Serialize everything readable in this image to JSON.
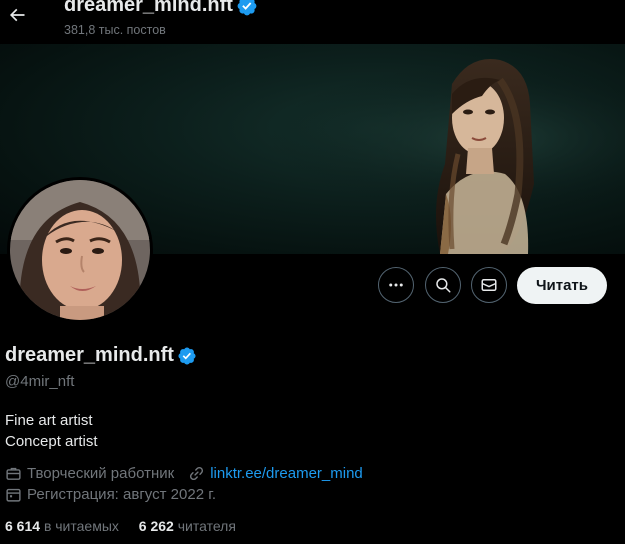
{
  "header": {
    "title": "dreamer_mind.nft",
    "post_count": "381,8 тыс. постов"
  },
  "actions": {
    "more_icon": "more-dots-icon",
    "search_icon": "search-icon",
    "message_icon": "mail-icon",
    "follow_label": "Читать"
  },
  "profile": {
    "display_name": "dreamer_mind.nft",
    "handle": "@4mir_nft",
    "bio_line1": "Fine art artist",
    "bio_line2": "Concept artist",
    "category": "Творческий работник",
    "link": "linktr.ee/dreamer_mind",
    "joined": "Регистрация: август 2022 г.",
    "following_count": "6 614",
    "following_label": "в читаемых",
    "followers_count": "6 262",
    "followers_label": "читателя"
  },
  "colors": {
    "background": "#000000",
    "text_primary": "#e7e9ea",
    "text_secondary": "#71767b",
    "accent_blue": "#1d9bf0",
    "verified_blue": "#1d9bf0",
    "button_light": "#eff3f4"
  }
}
